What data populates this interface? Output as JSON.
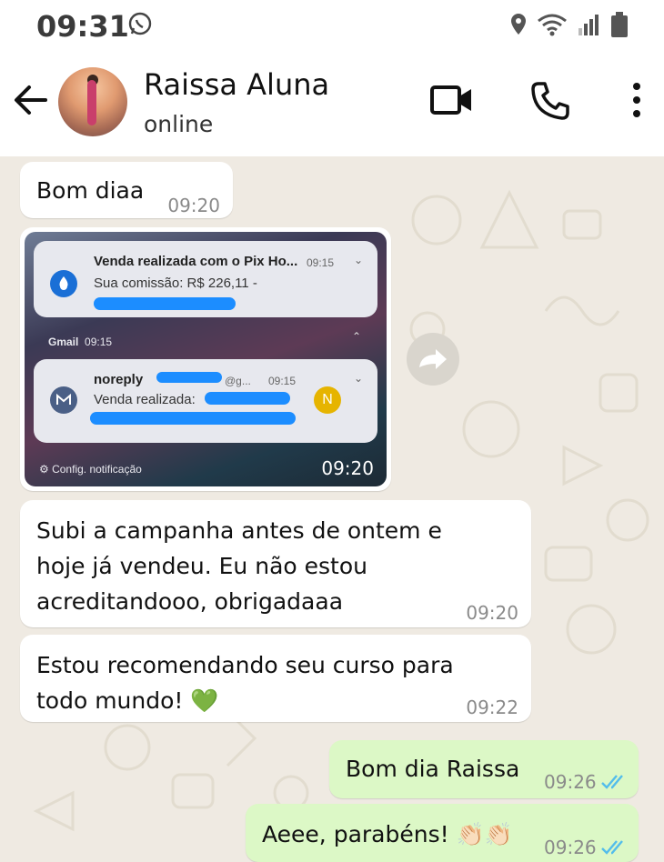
{
  "status_bar": {
    "time": "09:31"
  },
  "header": {
    "contact_name": "Raissa Aluna",
    "contact_status": "online"
  },
  "messages": [
    {
      "text": "Bom diaa",
      "time": "09:20"
    },
    {
      "time": "09:20"
    },
    {
      "lines": [
        "Subi a campanha antes de ontem e",
        "hoje já vendeu. Eu não estou",
        "acreditandooo, obrigadaaa"
      ],
      "time": "09:20"
    },
    {
      "lines": [
        "Estou recomendando seu curso para",
        "todo mundo! 💚"
      ],
      "time": "09:22"
    },
    {
      "text": "Bom dia Raissa",
      "time": "09:26"
    },
    {
      "text": "Aeee, parabéns! 👏🏻👏🏻",
      "time": "09:26"
    }
  ],
  "screenshot": {
    "notif1_title": "Venda realizada com o Pix Ho...",
    "notif1_time": "09:15",
    "notif1_text": "Sua comissão: R$ 226,11 -",
    "group_label": "Gmail",
    "group_time": "09:15",
    "notif2_sender": "noreply",
    "notif2_partial": "@g...",
    "notif2_time": "09:15",
    "notif2_text": "Venda realizada:",
    "avatar_letter": "N",
    "settings_label": "Config. notificação"
  },
  "colors": {
    "incoming": "#ffffff",
    "outgoing": "#dcf8c6",
    "read_ticks": "#53bdeb",
    "chat_bg": "#efeae2"
  }
}
